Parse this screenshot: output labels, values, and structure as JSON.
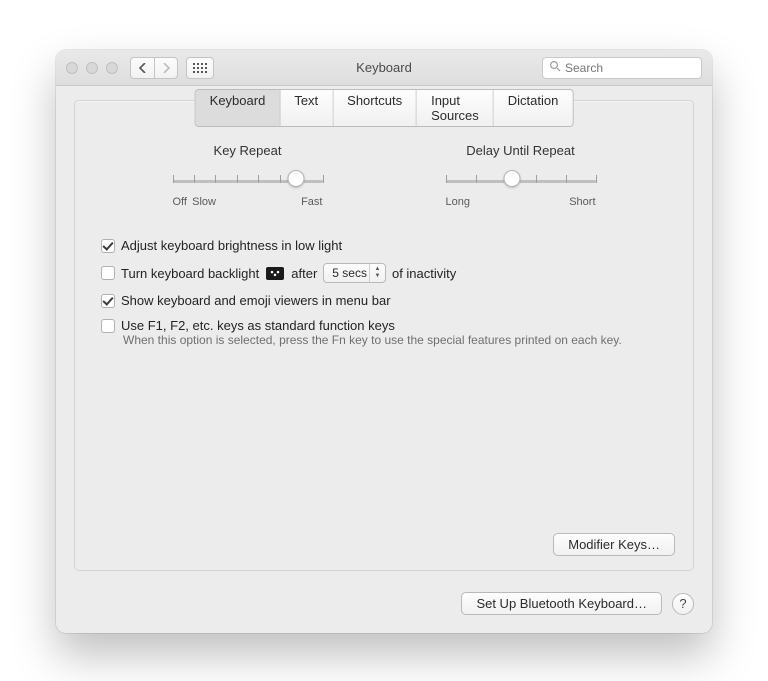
{
  "window": {
    "title": "Keyboard"
  },
  "search": {
    "placeholder": "Search"
  },
  "tabs": [
    "Keyboard",
    "Text",
    "Shortcuts",
    "Input Sources",
    "Dictation"
  ],
  "active_tab": 0,
  "slider_key_repeat": {
    "title": "Key Repeat",
    "left": "Off",
    "left2": "Slow",
    "right": "Fast",
    "ticks": 8,
    "pos_pct": 82
  },
  "slider_delay": {
    "title": "Delay Until Repeat",
    "left": "Long",
    "right": "Short",
    "ticks": 6,
    "pos_pct": 44
  },
  "opts": {
    "brightness_low_light": {
      "label": "Adjust keyboard brightness in low light",
      "checked": true
    },
    "backlight_off": {
      "prefix": "Turn keyboard backlight",
      "mid": "after",
      "select": "5 secs",
      "suffix": "of inactivity",
      "checked": false
    },
    "show_viewers": {
      "label": "Show keyboard and emoji viewers in menu bar",
      "checked": true
    },
    "fn_keys": {
      "label": "Use F1, F2, etc. keys as standard function keys",
      "hint": "When this option is selected, press the Fn key to use the special features printed on each key.",
      "checked": false
    }
  },
  "buttons": {
    "modifier": "Modifier Keys…",
    "bluetooth": "Set Up Bluetooth Keyboard…",
    "help": "?"
  }
}
